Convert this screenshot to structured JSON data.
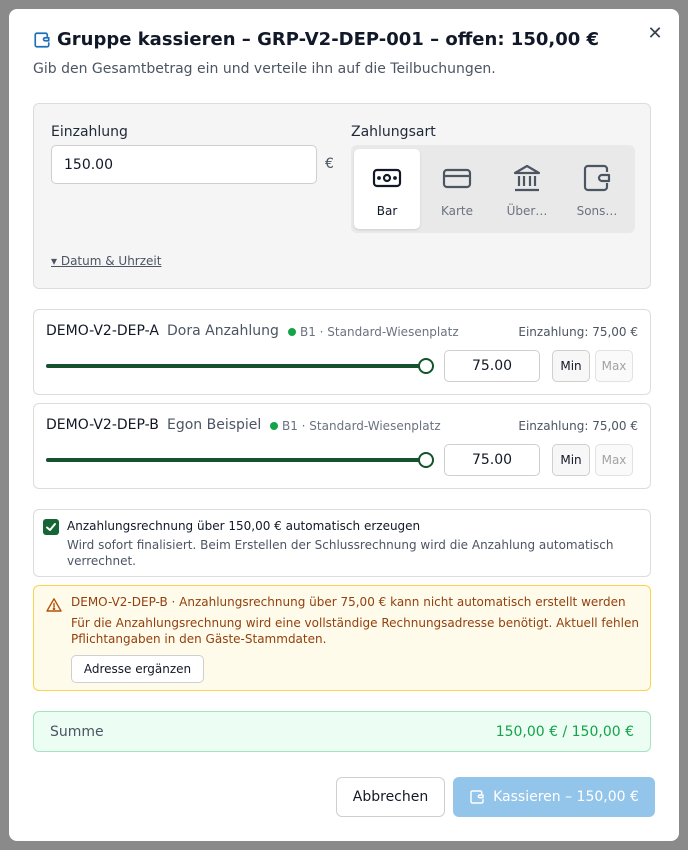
{
  "dialog": {
    "title": "Gruppe kassieren – GRP-V2-DEP-001 – offen: 150,00 €",
    "subtitle": "Gib den Gesamtbetrag ein und verteile ihn auf die Teilbuchungen.",
    "close_icon": "close-icon"
  },
  "payment": {
    "amount_label": "Einzahlung",
    "amount_value": "150.00",
    "currency": "€",
    "method_label": "Zahlungsart",
    "methods": [
      {
        "label": "Bar",
        "icon": "cash-icon",
        "selected": true
      },
      {
        "label": "Karte",
        "icon": "card-icon",
        "selected": false
      },
      {
        "label": "Über…",
        "icon": "bank-icon",
        "selected": false
      },
      {
        "label": "Sons…",
        "icon": "wallet-icon",
        "selected": false
      }
    ],
    "date_toggle": "▾ Datum & Uhrzeit"
  },
  "bookings": [
    {
      "code": "DEMO-V2-DEP-A",
      "guest": "Dora Anzahlung",
      "category": "B1 · Standard-Wiesenplatz",
      "deposit": "Einzahlung: 75,00 €",
      "value": "75.00",
      "slider_fraction": 1.0,
      "min_label": "Min",
      "max_label": "Max"
    },
    {
      "code": "DEMO-V2-DEP-B",
      "guest": "Egon Beispiel",
      "category": "B1 · Standard-Wiesenplatz",
      "deposit": "Einzahlung: 75,00 €",
      "value": "75.00",
      "slider_fraction": 1.0,
      "min_label": "Min",
      "max_label": "Max"
    }
  ],
  "invoice_option": {
    "checked": true,
    "label": "Anzahlungsrechnung über 150,00 € automatisch erzeugen",
    "help": "Wird sofort finalisiert. Beim Erstellen der Schlussrechnung wird die Anzahlung automatisch verrechnet."
  },
  "warning": {
    "title": "DEMO-V2-DEP-B · Anzahlungsrechnung über 75,00 € kann nicht automatisch erstellt werden",
    "text": "Für die Anzahlungsrechnung wird eine vollständige Rechnungsadresse benötigt. Aktuell fehlen Pflichtangaben in den Gäste-Stammdaten.",
    "button": "Adresse ergänzen"
  },
  "summary": {
    "label": "Summe",
    "value": "150,00 € / 150,00 €"
  },
  "footer": {
    "cancel": "Abbrechen",
    "submit": "Kassieren – 150,00 €"
  },
  "colors": {
    "primary_disabled": "#93c5ea",
    "success": "#16a34a",
    "slider": "#14532d",
    "warning_text": "#92400e"
  }
}
